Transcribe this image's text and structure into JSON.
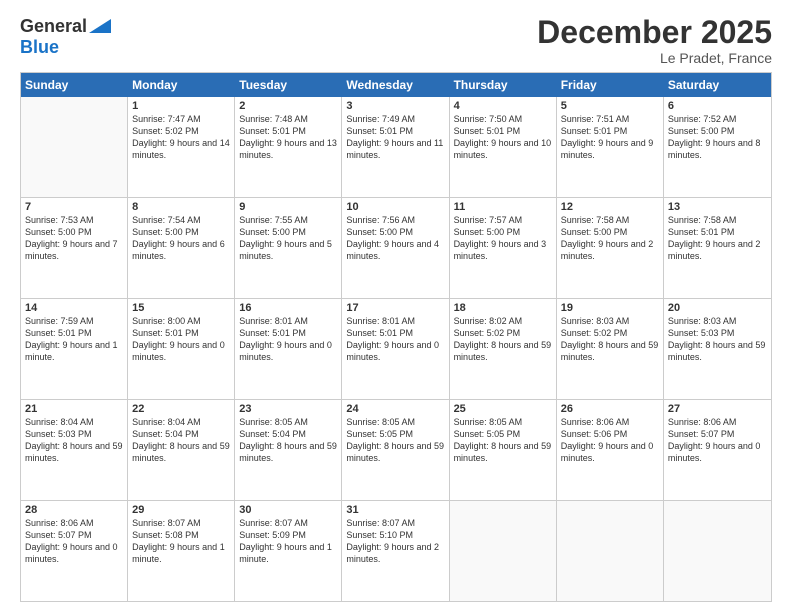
{
  "header": {
    "logo": {
      "line1": "General",
      "line2": "Blue"
    },
    "title": "December 2025",
    "location": "Le Pradet, France"
  },
  "weekdays": [
    "Sunday",
    "Monday",
    "Tuesday",
    "Wednesday",
    "Thursday",
    "Friday",
    "Saturday"
  ],
  "weeks": [
    [
      {
        "day": "",
        "sunrise": "",
        "sunset": "",
        "daylight": "",
        "empty": true
      },
      {
        "day": "1",
        "sunrise": "Sunrise: 7:47 AM",
        "sunset": "Sunset: 5:02 PM",
        "daylight": "Daylight: 9 hours and 14 minutes.",
        "empty": false
      },
      {
        "day": "2",
        "sunrise": "Sunrise: 7:48 AM",
        "sunset": "Sunset: 5:01 PM",
        "daylight": "Daylight: 9 hours and 13 minutes.",
        "empty": false
      },
      {
        "day": "3",
        "sunrise": "Sunrise: 7:49 AM",
        "sunset": "Sunset: 5:01 PM",
        "daylight": "Daylight: 9 hours and 11 minutes.",
        "empty": false
      },
      {
        "day": "4",
        "sunrise": "Sunrise: 7:50 AM",
        "sunset": "Sunset: 5:01 PM",
        "daylight": "Daylight: 9 hours and 10 minutes.",
        "empty": false
      },
      {
        "day": "5",
        "sunrise": "Sunrise: 7:51 AM",
        "sunset": "Sunset: 5:01 PM",
        "daylight": "Daylight: 9 hours and 9 minutes.",
        "empty": false
      },
      {
        "day": "6",
        "sunrise": "Sunrise: 7:52 AM",
        "sunset": "Sunset: 5:00 PM",
        "daylight": "Daylight: 9 hours and 8 minutes.",
        "empty": false
      }
    ],
    [
      {
        "day": "7",
        "sunrise": "Sunrise: 7:53 AM",
        "sunset": "Sunset: 5:00 PM",
        "daylight": "Daylight: 9 hours and 7 minutes.",
        "empty": false
      },
      {
        "day": "8",
        "sunrise": "Sunrise: 7:54 AM",
        "sunset": "Sunset: 5:00 PM",
        "daylight": "Daylight: 9 hours and 6 minutes.",
        "empty": false
      },
      {
        "day": "9",
        "sunrise": "Sunrise: 7:55 AM",
        "sunset": "Sunset: 5:00 PM",
        "daylight": "Daylight: 9 hours and 5 minutes.",
        "empty": false
      },
      {
        "day": "10",
        "sunrise": "Sunrise: 7:56 AM",
        "sunset": "Sunset: 5:00 PM",
        "daylight": "Daylight: 9 hours and 4 minutes.",
        "empty": false
      },
      {
        "day": "11",
        "sunrise": "Sunrise: 7:57 AM",
        "sunset": "Sunset: 5:00 PM",
        "daylight": "Daylight: 9 hours and 3 minutes.",
        "empty": false
      },
      {
        "day": "12",
        "sunrise": "Sunrise: 7:58 AM",
        "sunset": "Sunset: 5:00 PM",
        "daylight": "Daylight: 9 hours and 2 minutes.",
        "empty": false
      },
      {
        "day": "13",
        "sunrise": "Sunrise: 7:58 AM",
        "sunset": "Sunset: 5:01 PM",
        "daylight": "Daylight: 9 hours and 2 minutes.",
        "empty": false
      }
    ],
    [
      {
        "day": "14",
        "sunrise": "Sunrise: 7:59 AM",
        "sunset": "Sunset: 5:01 PM",
        "daylight": "Daylight: 9 hours and 1 minute.",
        "empty": false
      },
      {
        "day": "15",
        "sunrise": "Sunrise: 8:00 AM",
        "sunset": "Sunset: 5:01 PM",
        "daylight": "Daylight: 9 hours and 0 minutes.",
        "empty": false
      },
      {
        "day": "16",
        "sunrise": "Sunrise: 8:01 AM",
        "sunset": "Sunset: 5:01 PM",
        "daylight": "Daylight: 9 hours and 0 minutes.",
        "empty": false
      },
      {
        "day": "17",
        "sunrise": "Sunrise: 8:01 AM",
        "sunset": "Sunset: 5:01 PM",
        "daylight": "Daylight: 9 hours and 0 minutes.",
        "empty": false
      },
      {
        "day": "18",
        "sunrise": "Sunrise: 8:02 AM",
        "sunset": "Sunset: 5:02 PM",
        "daylight": "Daylight: 8 hours and 59 minutes.",
        "empty": false
      },
      {
        "day": "19",
        "sunrise": "Sunrise: 8:03 AM",
        "sunset": "Sunset: 5:02 PM",
        "daylight": "Daylight: 8 hours and 59 minutes.",
        "empty": false
      },
      {
        "day": "20",
        "sunrise": "Sunrise: 8:03 AM",
        "sunset": "Sunset: 5:03 PM",
        "daylight": "Daylight: 8 hours and 59 minutes.",
        "empty": false
      }
    ],
    [
      {
        "day": "21",
        "sunrise": "Sunrise: 8:04 AM",
        "sunset": "Sunset: 5:03 PM",
        "daylight": "Daylight: 8 hours and 59 minutes.",
        "empty": false
      },
      {
        "day": "22",
        "sunrise": "Sunrise: 8:04 AM",
        "sunset": "Sunset: 5:04 PM",
        "daylight": "Daylight: 8 hours and 59 minutes.",
        "empty": false
      },
      {
        "day": "23",
        "sunrise": "Sunrise: 8:05 AM",
        "sunset": "Sunset: 5:04 PM",
        "daylight": "Daylight: 8 hours and 59 minutes.",
        "empty": false
      },
      {
        "day": "24",
        "sunrise": "Sunrise: 8:05 AM",
        "sunset": "Sunset: 5:05 PM",
        "daylight": "Daylight: 8 hours and 59 minutes.",
        "empty": false
      },
      {
        "day": "25",
        "sunrise": "Sunrise: 8:05 AM",
        "sunset": "Sunset: 5:05 PM",
        "daylight": "Daylight: 8 hours and 59 minutes.",
        "empty": false
      },
      {
        "day": "26",
        "sunrise": "Sunrise: 8:06 AM",
        "sunset": "Sunset: 5:06 PM",
        "daylight": "Daylight: 9 hours and 0 minutes.",
        "empty": false
      },
      {
        "day": "27",
        "sunrise": "Sunrise: 8:06 AM",
        "sunset": "Sunset: 5:07 PM",
        "daylight": "Daylight: 9 hours and 0 minutes.",
        "empty": false
      }
    ],
    [
      {
        "day": "28",
        "sunrise": "Sunrise: 8:06 AM",
        "sunset": "Sunset: 5:07 PM",
        "daylight": "Daylight: 9 hours and 0 minutes.",
        "empty": false
      },
      {
        "day": "29",
        "sunrise": "Sunrise: 8:07 AM",
        "sunset": "Sunset: 5:08 PM",
        "daylight": "Daylight: 9 hours and 1 minute.",
        "empty": false
      },
      {
        "day": "30",
        "sunrise": "Sunrise: 8:07 AM",
        "sunset": "Sunset: 5:09 PM",
        "daylight": "Daylight: 9 hours and 1 minute.",
        "empty": false
      },
      {
        "day": "31",
        "sunrise": "Sunrise: 8:07 AM",
        "sunset": "Sunset: 5:10 PM",
        "daylight": "Daylight: 9 hours and 2 minutes.",
        "empty": false
      },
      {
        "day": "",
        "sunrise": "",
        "sunset": "",
        "daylight": "",
        "empty": true
      },
      {
        "day": "",
        "sunrise": "",
        "sunset": "",
        "daylight": "",
        "empty": true
      },
      {
        "day": "",
        "sunrise": "",
        "sunset": "",
        "daylight": "",
        "empty": true
      }
    ]
  ]
}
